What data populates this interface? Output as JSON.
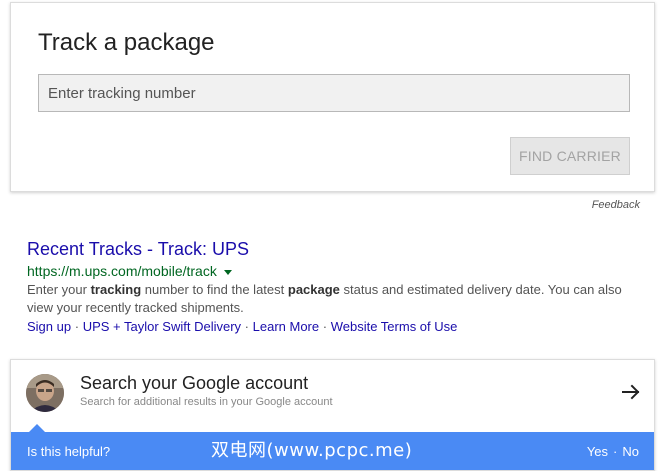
{
  "track_card": {
    "title": "Track a package",
    "input_placeholder": "Enter tracking number",
    "input_value": "",
    "find_carrier_label": "FIND CARRIER"
  },
  "feedback_label": "Feedback",
  "result": {
    "title": "Recent Tracks - Track: UPS",
    "url": "https://m.ups.com/mobile/track",
    "snippet": {
      "part1": "Enter your ",
      "bold1": "tracking",
      "part2": " number to find the latest ",
      "bold2": "package",
      "part3": " status and estimated delivery date. You can also view your recently tracked shipments."
    },
    "sitelinks": [
      "Sign up",
      "UPS + Taylor Swift Delivery",
      "Learn More",
      "Website Terms of Use"
    ],
    "sitelink_separator": "·"
  },
  "account_card": {
    "title": "Search your Google account",
    "subtitle": "Search for additional results in your Google account",
    "avatar_icon": "user-avatar",
    "arrow_icon": "arrow-right-icon"
  },
  "helpful_bar": {
    "question": "Is this helpful?",
    "yes_label": "Yes",
    "no_label": "No",
    "separator": "·",
    "watermark": "双电网(www.pcpc.me)"
  },
  "colors": {
    "link": "#1a0dab",
    "url_green": "#006621",
    "helpful_blue": "#4a8af4"
  }
}
